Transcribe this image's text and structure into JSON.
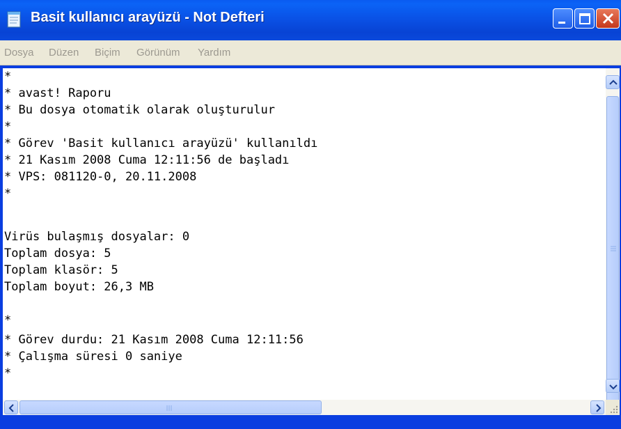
{
  "window": {
    "title": "Basit kullanıcı arayüzü - Not Defteri",
    "icon": "notepad-icon"
  },
  "titlebar_buttons": [
    "minimize-icon",
    "maximize-icon",
    "close-icon"
  ],
  "menu": {
    "items": [
      "Dosya",
      "Düzen",
      "Biçim",
      "Görünüm",
      "Yardım"
    ]
  },
  "document": {
    "lines": [
      "*",
      "* avast! Raporu",
      "* Bu dosya otomatik olarak oluşturulur",
      "*",
      "* Görev 'Basit kullanıcı arayüzü' kullanıldı",
      "* 21 Kasım 2008 Cuma 12:11:56 de başladı",
      "* VPS: 081120-0, 20.11.2008",
      "*",
      "",
      "Virüs bulaşmış dosyalar: 0",
      "Toplam dosya: 5",
      "Toplam klasör: 5",
      "Toplam boyut: 26,3 MB",
      "",
      "*",
      "* Görev durdu: 21 Kasım 2008 Cuma 12:11:56",
      "* Çalışma süresi 0 saniye",
      "*"
    ]
  },
  "colors": {
    "titlebar": "#0a52e6",
    "menubar": "#ece9d8",
    "close_button": "#c4371c"
  }
}
